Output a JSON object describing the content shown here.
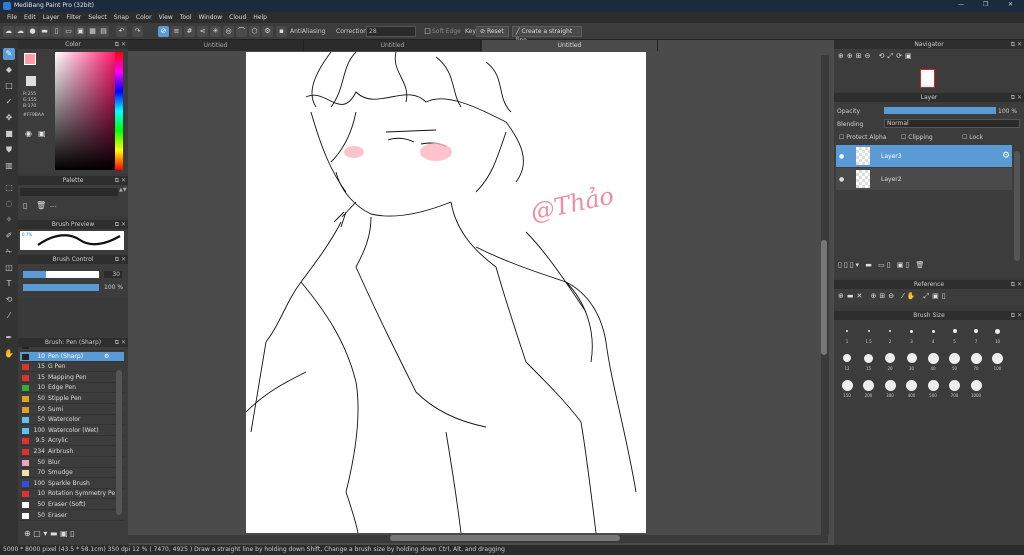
{
  "app": {
    "title": "MediBang Paint Pro (32bit)"
  },
  "menu": [
    "File",
    "Edit",
    "Layer",
    "Filter",
    "Select",
    "Snap",
    "Color",
    "View",
    "Tool",
    "Window",
    "Cloud",
    "Help"
  ],
  "toolbar": {
    "antialiasing": "AntiAliasing",
    "correction_label": "Correction",
    "correction_value": "28",
    "soft_edge": "Soft Edge",
    "key": "Key",
    "reset": "Reset",
    "straight_line": "Create a straight line"
  },
  "tabs": [
    "Untitled",
    "Untitled",
    "Untitled"
  ],
  "color_panel": {
    "title": "Color",
    "r": "R:255",
    "g": "G:155",
    "b": "B:170",
    "hex": "#FF9BAA"
  },
  "palette_panel": {
    "title": "Palette",
    "value": "---"
  },
  "brush_preview": {
    "title": "Brush Preview",
    "size": "0.7%"
  },
  "brush_control": {
    "title": "Brush Control",
    "size": "30",
    "opacity": "100 %",
    "size_fill": 0.3,
    "opacity_fill": 1.0
  },
  "brush_list": {
    "title": "Brush: Pen (Sharp)",
    "items": [
      {
        "size": "10",
        "name": "Pen",
        "color": "#222222"
      },
      {
        "size": "10",
        "name": "Pen (Sharp)",
        "color": "#222222",
        "selected": true
      },
      {
        "size": "15",
        "name": "G Pen",
        "color": "#e03030"
      },
      {
        "size": "15",
        "name": "Mapping Pen",
        "color": "#e03030"
      },
      {
        "size": "10",
        "name": "Edge Pen",
        "color": "#30b030"
      },
      {
        "size": "50",
        "name": "Stipple Pen",
        "color": "#e0a020"
      },
      {
        "size": "50",
        "name": "Sumi",
        "color": "#e0a020"
      },
      {
        "size": "50",
        "name": "Watercolor",
        "color": "#60c0f0"
      },
      {
        "size": "100",
        "name": "Watercolor (Wet)",
        "color": "#60c0f0"
      },
      {
        "size": "9.5",
        "name": "Acrylic",
        "color": "#e03030"
      },
      {
        "size": "234",
        "name": "Airbrush",
        "color": "#e03030"
      },
      {
        "size": "50",
        "name": "Blur",
        "color": "#f0a0c0"
      },
      {
        "size": "70",
        "name": "Smudge",
        "color": "#f0e0b0"
      },
      {
        "size": "100",
        "name": "Sparkle Brush",
        "color": "#3050e0"
      },
      {
        "size": "10",
        "name": "Rotation Symmetry Pe",
        "color": "#e03030"
      },
      {
        "size": "50",
        "name": "Eraser (Soft)",
        "color": "#ffffff"
      },
      {
        "size": "50",
        "name": "Eraser",
        "color": "#ffffff"
      }
    ]
  },
  "navigator": {
    "title": "Navigator"
  },
  "layer_panel": {
    "title": "Layer",
    "opacity_label": "Opacity",
    "opacity_value": "100 %",
    "blending_label": "Blending",
    "blending_value": "Normal",
    "protect_alpha": "Protect Alpha",
    "clipping": "Clipping",
    "lock": "Lock",
    "layers": [
      "Layer3",
      "Layer2"
    ]
  },
  "reference": {
    "title": "Reference"
  },
  "brush_size": {
    "title": "Brush Size",
    "sizes": [
      "1",
      "1.5",
      "2",
      "3",
      "4",
      "5",
      "7",
      "10",
      "12",
      "15",
      "20",
      "30",
      "40",
      "50",
      "70",
      "100",
      "150",
      "200",
      "300",
      "400",
      "500",
      "700",
      "1000"
    ]
  },
  "canvas": {
    "signature": "@Thảo"
  },
  "status": {
    "text": "5000 * 8000 pixel  (43.5 * 58.1cm)  350 dpi  12 %  ( 7470, 4925 )  Draw a straight line by holding down Shift, Change a brush size by holding down Ctrl, Alt, and dragging"
  }
}
